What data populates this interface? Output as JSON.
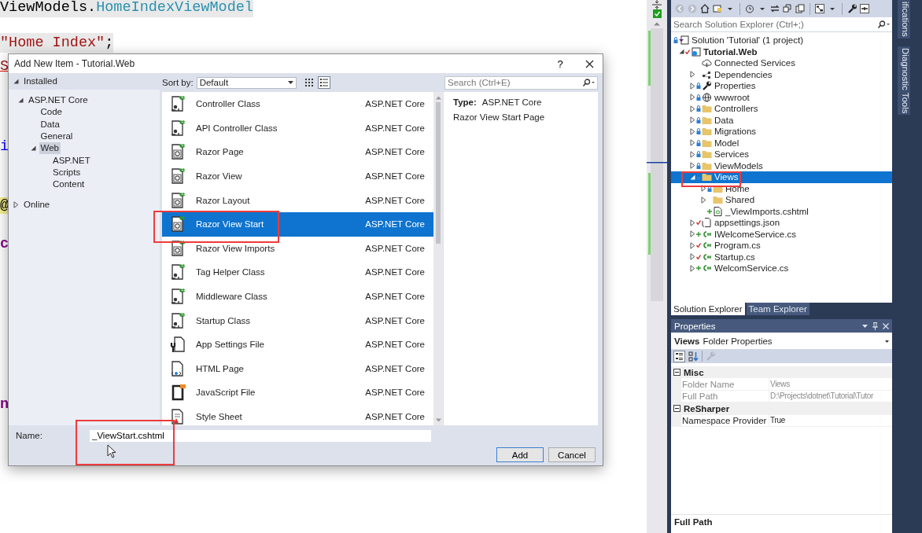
{
  "editor": {
    "code_lines": [
      {
        "highlighted": true,
        "segments": [
          {
            "text": "ViewModels.",
            "kind": "plain"
          },
          {
            "text": "HomeIndexViewModel",
            "kind": "type"
          }
        ]
      },
      {
        "highlighted": true,
        "segments": [
          {
            "text": "\"Home Index\"",
            "kind": "string"
          },
          {
            "text": ";",
            "kind": "plain"
          }
        ]
      },
      {
        "highlighted": false,
        "segments": [
          {
            "text": "S",
            "kind": "error"
          }
        ]
      },
      {
        "highlighted": false,
        "segments": [
          {
            "text": "i",
            "kind": "keyword"
          }
        ]
      },
      {
        "highlighted": false,
        "segments": [
          {
            "text": "@",
            "kind": "razor"
          }
        ]
      },
      {
        "highlighted": false,
        "segments": [
          {
            "text": "c",
            "kind": "member"
          }
        ]
      },
      {
        "highlighted": false,
        "segments": [
          {
            "text": "n",
            "kind": "member"
          }
        ]
      }
    ]
  },
  "dialog": {
    "title": "Add New Item - Tutorial.Web",
    "help": "?",
    "sections": [
      {
        "label": "Installed",
        "expanded": true,
        "selected": false,
        "children": [
          {
            "label": "ASP.NET Core",
            "expanded": true,
            "selected": false,
            "children": [
              {
                "label": "Code",
                "selected": false
              },
              {
                "label": "Data",
                "selected": false
              },
              {
                "label": "General",
                "selected": false
              },
              {
                "label": "Web",
                "expanded": true,
                "selected": true,
                "children": [
                  {
                    "label": "ASP.NET",
                    "selected": false
                  },
                  {
                    "label": "Scripts",
                    "selected": false
                  },
                  {
                    "label": "Content",
                    "selected": false
                  }
                ]
              }
            ]
          }
        ]
      },
      {
        "label": "Online",
        "expanded": false,
        "selected": false
      }
    ],
    "sort_label": "Sort by:",
    "sort_value": "Default",
    "view_modes": [
      {
        "kind": "grid",
        "selected": false
      },
      {
        "kind": "list",
        "selected": true
      }
    ],
    "search": {
      "placeholder": "Search (Ctrl+E)"
    },
    "templates": [
      {
        "name": "Controller Class",
        "category": "ASP.NET Core",
        "kind": "class",
        "selected": false
      },
      {
        "name": "API Controller Class",
        "category": "ASP.NET Core",
        "kind": "class",
        "selected": false
      },
      {
        "name": "Razor Page",
        "category": "ASP.NET Core",
        "kind": "razor",
        "selected": false
      },
      {
        "name": "Razor View",
        "category": "ASP.NET Core",
        "kind": "razor",
        "selected": false
      },
      {
        "name": "Razor Layout",
        "category": "ASP.NET Core",
        "kind": "razor",
        "selected": false
      },
      {
        "name": "Razor View Start",
        "category": "ASP.NET Core",
        "kind": "razor",
        "selected": true
      },
      {
        "name": "Razor View Imports",
        "category": "ASP.NET Core",
        "kind": "razor",
        "selected": false
      },
      {
        "name": "Tag Helper Class",
        "category": "ASP.NET Core",
        "kind": "class",
        "selected": false
      },
      {
        "name": "Middleware Class",
        "category": "ASP.NET Core",
        "kind": "class",
        "selected": false
      },
      {
        "name": "Startup Class",
        "category": "ASP.NET Core",
        "kind": "class",
        "selected": false
      },
      {
        "name": "App Settings File",
        "category": "ASP.NET Core",
        "kind": "settings",
        "selected": false
      },
      {
        "name": "HTML Page",
        "category": "ASP.NET Core",
        "kind": "html",
        "selected": false
      },
      {
        "name": "JavaScript File",
        "category": "ASP.NET Core",
        "kind": "script",
        "selected": false
      },
      {
        "name": "Style Sheet",
        "category": "ASP.NET Core",
        "kind": "stylesheet",
        "selected": false
      }
    ],
    "details": {
      "type_label": "Type:",
      "type_value": "ASP.NET Core",
      "description": "Razor View Start Page"
    },
    "name_label": "Name:",
    "name_value": "_ViewStart.cshtml",
    "buttons": [
      {
        "label": "Add",
        "default": true
      },
      {
        "label": "Cancel",
        "default": false
      }
    ]
  },
  "solution_explorer": {
    "search": {
      "placeholder": "Search Solution Explorer (Ctrl+;)"
    },
    "tree": [
      {
        "label": "Solution 'Tutorial' (1 project)",
        "kind": "solution",
        "locked": true,
        "added": false,
        "modified": false,
        "selected": false,
        "children": [
          {
            "label": "Tutorial.Web",
            "kind": "project",
            "locked": false,
            "added": false,
            "modified": true,
            "expanded": true,
            "selected": false,
            "children": [
              {
                "label": "Connected Services",
                "kind": "cloud",
                "locked": false,
                "added": false,
                "modified": false,
                "selected": false
              },
              {
                "label": "Dependencies",
                "kind": "dependencies",
                "locked": false,
                "added": false,
                "modified": false,
                "expanded": false,
                "selected": false
              },
              {
                "label": "Properties",
                "kind": "wrench",
                "locked": true,
                "added": false,
                "modified": false,
                "expanded": false,
                "selected": false
              },
              {
                "label": "wwwroot",
                "kind": "globe",
                "locked": true,
                "added": false,
                "modified": false,
                "expanded": false,
                "selected": false
              },
              {
                "label": "Controllers",
                "kind": "folder",
                "locked": true,
                "added": false,
                "modified": false,
                "expanded": false,
                "selected": false
              },
              {
                "label": "Data",
                "kind": "folder",
                "locked": true,
                "added": false,
                "modified": false,
                "expanded": false,
                "selected": false
              },
              {
                "label": "Migrations",
                "kind": "folder",
                "locked": true,
                "added": false,
                "modified": false,
                "expanded": false,
                "selected": false
              },
              {
                "label": "Model",
                "kind": "folder",
                "locked": true,
                "added": false,
                "modified": false,
                "expanded": false,
                "selected": false
              },
              {
                "label": "Services",
                "kind": "folder",
                "locked": true,
                "added": false,
                "modified": false,
                "expanded": false,
                "selected": false
              },
              {
                "label": "ViewModels",
                "kind": "folder",
                "locked": true,
                "added": false,
                "modified": false,
                "expanded": false,
                "selected": false
              },
              {
                "label": "Views",
                "kind": "folder",
                "locked": true,
                "added": false,
                "modified": false,
                "expanded": true,
                "selected": true,
                "children": [
                  {
                    "label": "Home",
                    "kind": "folder",
                    "locked": true,
                    "added": false,
                    "modified": false,
                    "expanded": false,
                    "selected": false
                  },
                  {
                    "label": "Shared",
                    "kind": "folder",
                    "locked": false,
                    "added": false,
                    "modified": false,
                    "expanded": false,
                    "selected": false
                  },
                  {
                    "label": "_ViewImports.cshtml",
                    "kind": "razor",
                    "locked": false,
                    "added": true,
                    "modified": false,
                    "selected": false
                  }
                ]
              },
              {
                "label": "appsettings.json",
                "kind": "json",
                "locked": false,
                "added": false,
                "modified": true,
                "expanded": false,
                "selected": false
              },
              {
                "label": "IWelcomeService.cs",
                "kind": "csharp",
                "locked": false,
                "added": true,
                "modified": false,
                "expanded": false,
                "selected": false
              },
              {
                "label": "Program.cs",
                "kind": "csharp",
                "locked": false,
                "added": false,
                "modified": true,
                "expanded": false,
                "selected": false
              },
              {
                "label": "Startup.cs",
                "kind": "csharp",
                "locked": false,
                "added": false,
                "modified": true,
                "expanded": false,
                "selected": false
              },
              {
                "label": "WelcomService.cs",
                "kind": "csharp",
                "locked": false,
                "added": true,
                "modified": false,
                "expanded": false,
                "selected": false
              }
            ]
          }
        ]
      }
    ],
    "tabs": [
      {
        "label": "Solution Explorer",
        "selected": true
      },
      {
        "label": "Team Explorer",
        "selected": false
      }
    ]
  },
  "properties": {
    "title": "Properties",
    "object_name": "Views",
    "object_type": "Folder Properties",
    "categories": [
      {
        "name": "Misc",
        "expanded": true,
        "rows": [
          {
            "name": "Folder Name",
            "value": "Views",
            "readonly": true
          },
          {
            "name": "Full Path",
            "value": "D:\\Projects\\dotnet\\Tutorial\\Tutor",
            "readonly": true
          }
        ]
      },
      {
        "name": "ReSharper",
        "expanded": true,
        "rows": [
          {
            "name": "Namespace Provider",
            "value": "True",
            "readonly": false
          }
        ]
      }
    ],
    "description_title": "Full Path"
  },
  "side_tabs": [
    {
      "label": "ifications"
    },
    {
      "label": "Diagnostic Tools"
    }
  ]
}
